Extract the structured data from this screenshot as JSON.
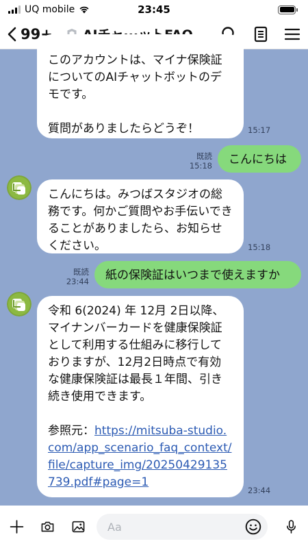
{
  "status_bar": {
    "carrier": "UQ mobile",
    "time": "23:45"
  },
  "header": {
    "back_count": "99+",
    "title": "AIチャ···ットFAQ"
  },
  "messages": [
    {
      "side": "left",
      "text": "このアカウントは、マイナ保険証についてのAIチャットボットのデモです。\n\n質問がありましたらどうぞ！",
      "time": "15:17"
    },
    {
      "side": "right",
      "text": "こんにちは",
      "read": "既読",
      "time": "15:18"
    },
    {
      "side": "left",
      "text": "こんにちは。みつばスタジオの総務です。何かご質問やお手伝いできることがありましたら、お知らせください。",
      "time": "15:18"
    },
    {
      "side": "right",
      "text": "紙の保険証はいつまで使えますか",
      "read": "既読",
      "time": "23:44"
    },
    {
      "side": "left",
      "text": " 令和 6(2024) 年 12月 2日以降、マイナンバーカードを健康保険証として利用する仕組みに移行しておりますが、12月2日時点で有効な健康保険証は最長１年間、引き続き使用できます。\n\n 参照元：",
      "link": "https://mitsuba-studio.com/app_scenario_faq_context/file/capture_img/20250429135739.pdf#page=1",
      "time": "23:44"
    }
  ],
  "input": {
    "placeholder": "Aa"
  },
  "colors": {
    "chat_bg": "#8fa6ce",
    "sent_bubble": "#86d97c",
    "received_bubble": "#ffffff",
    "link": "#2b5ab3"
  }
}
